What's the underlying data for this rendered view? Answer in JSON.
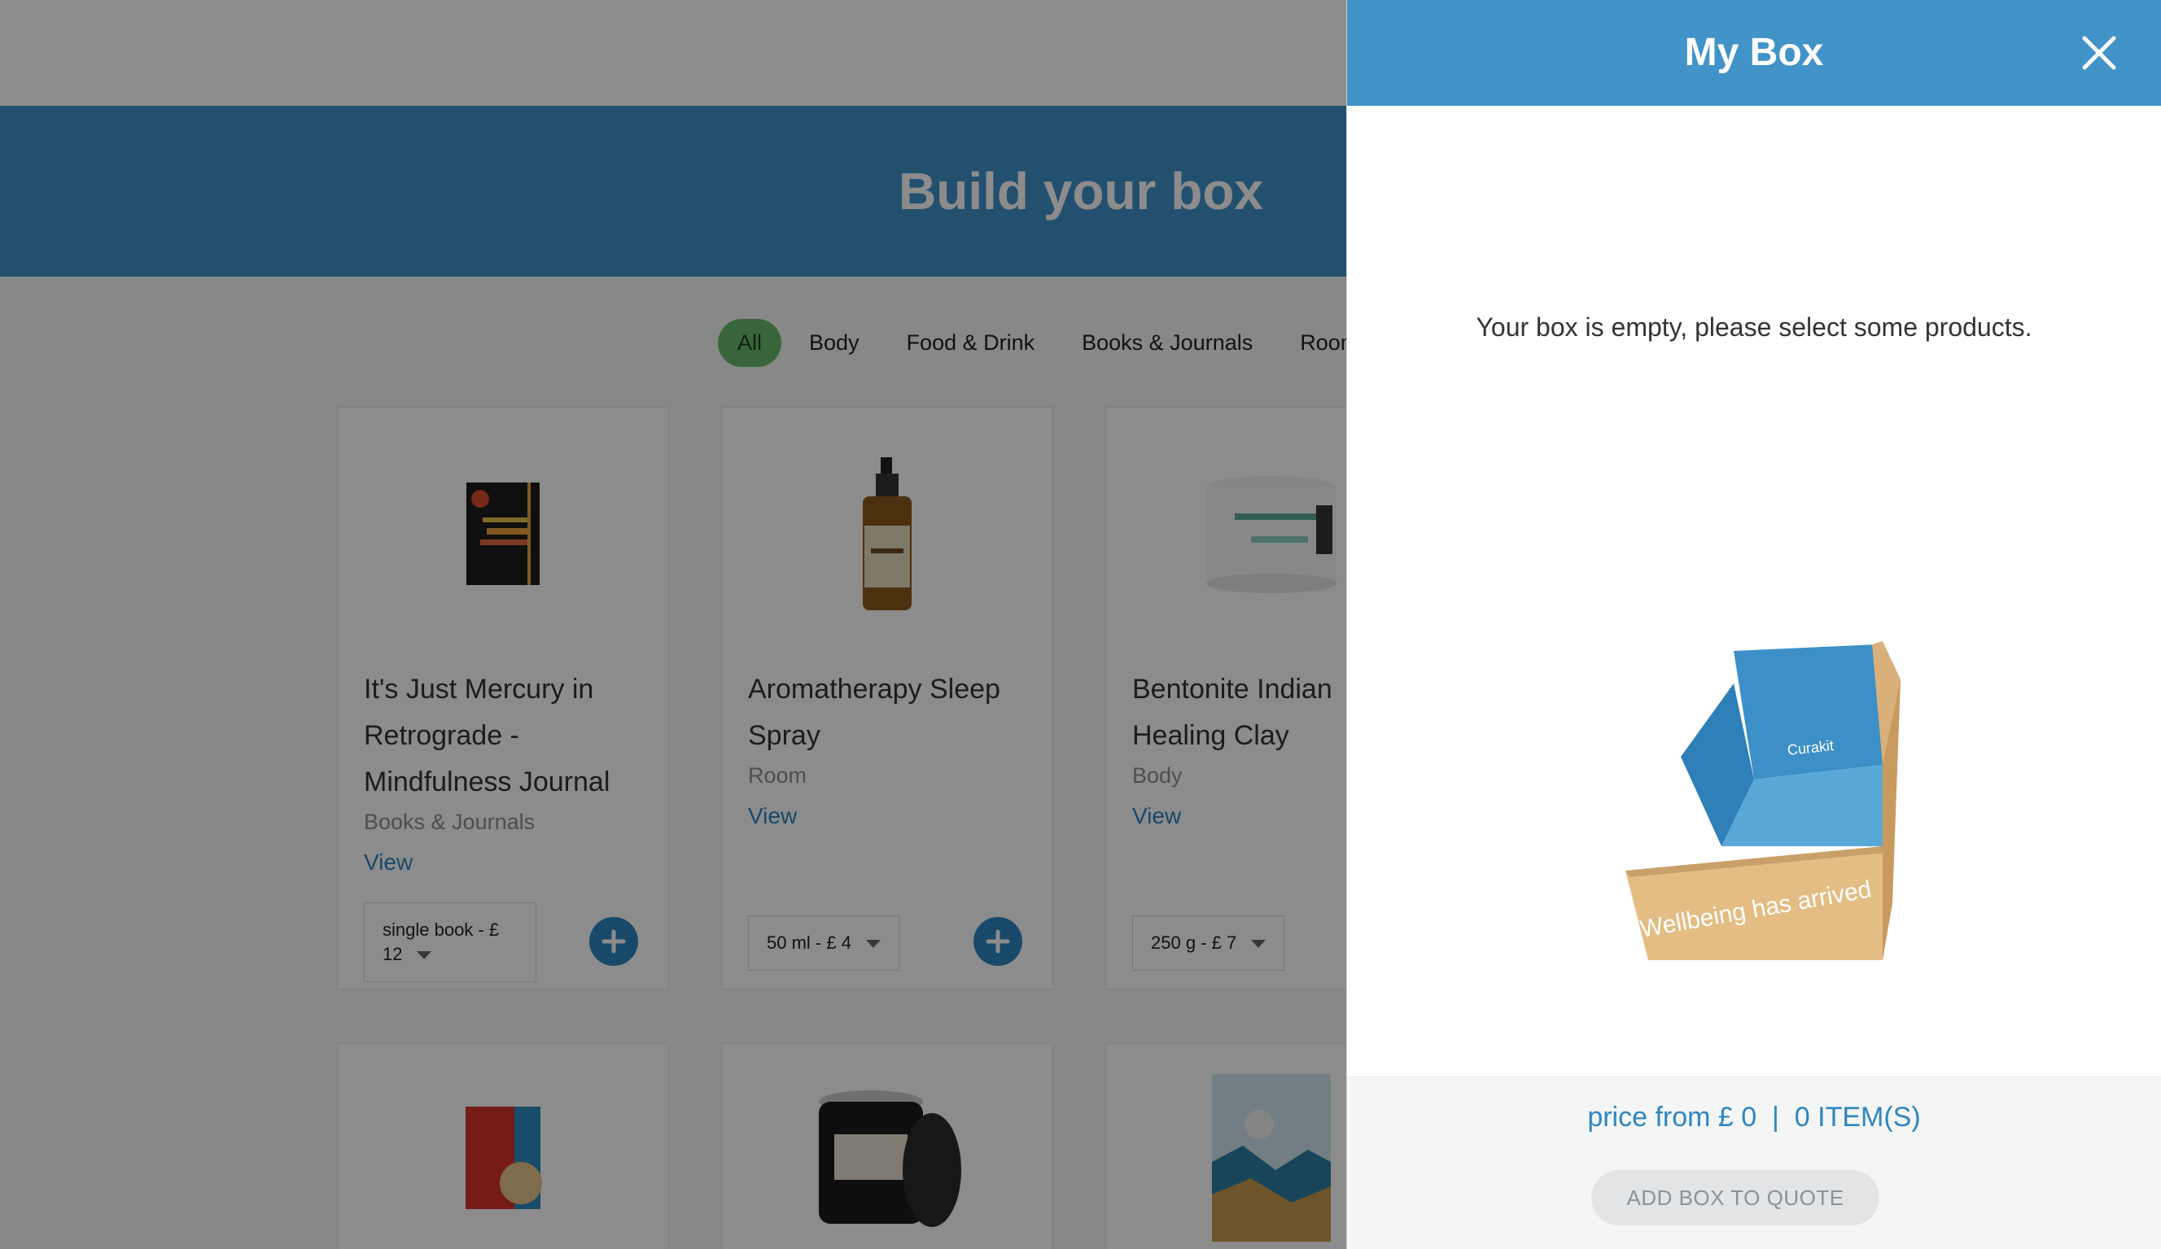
{
  "hero": {
    "title": "Build your box"
  },
  "filters": [
    "All",
    "Body",
    "Food & Drink",
    "Books & Journals",
    "Room"
  ],
  "products": [
    {
      "name": "It's Just Mercury in Retrograde - Mindfulness Journal",
      "category": "Books & Journals",
      "view": "View",
      "variant": "single book - £ 12"
    },
    {
      "name": "Aromatherapy Sleep Spray",
      "category": "Room",
      "view": "View",
      "variant": "50 ml - £ 4"
    },
    {
      "name": "Bentonite Indian Healing Clay",
      "category": "Body",
      "view": "View",
      "variant": "250 g - £ 7"
    }
  ],
  "drawer": {
    "title": "My Box",
    "empty_message": "Your box is empty, please select some products.",
    "summary": "price from £ 0  |  0 ITEM(S)",
    "add_to_quote": "ADD BOX TO QUOTE",
    "box_print": "Wellbeing has arrived",
    "box_brand": "Curakit"
  },
  "colors": {
    "brand_blue": "#4193c8",
    "link_blue": "#2e86c1",
    "active_filter": "#66bb6a"
  }
}
